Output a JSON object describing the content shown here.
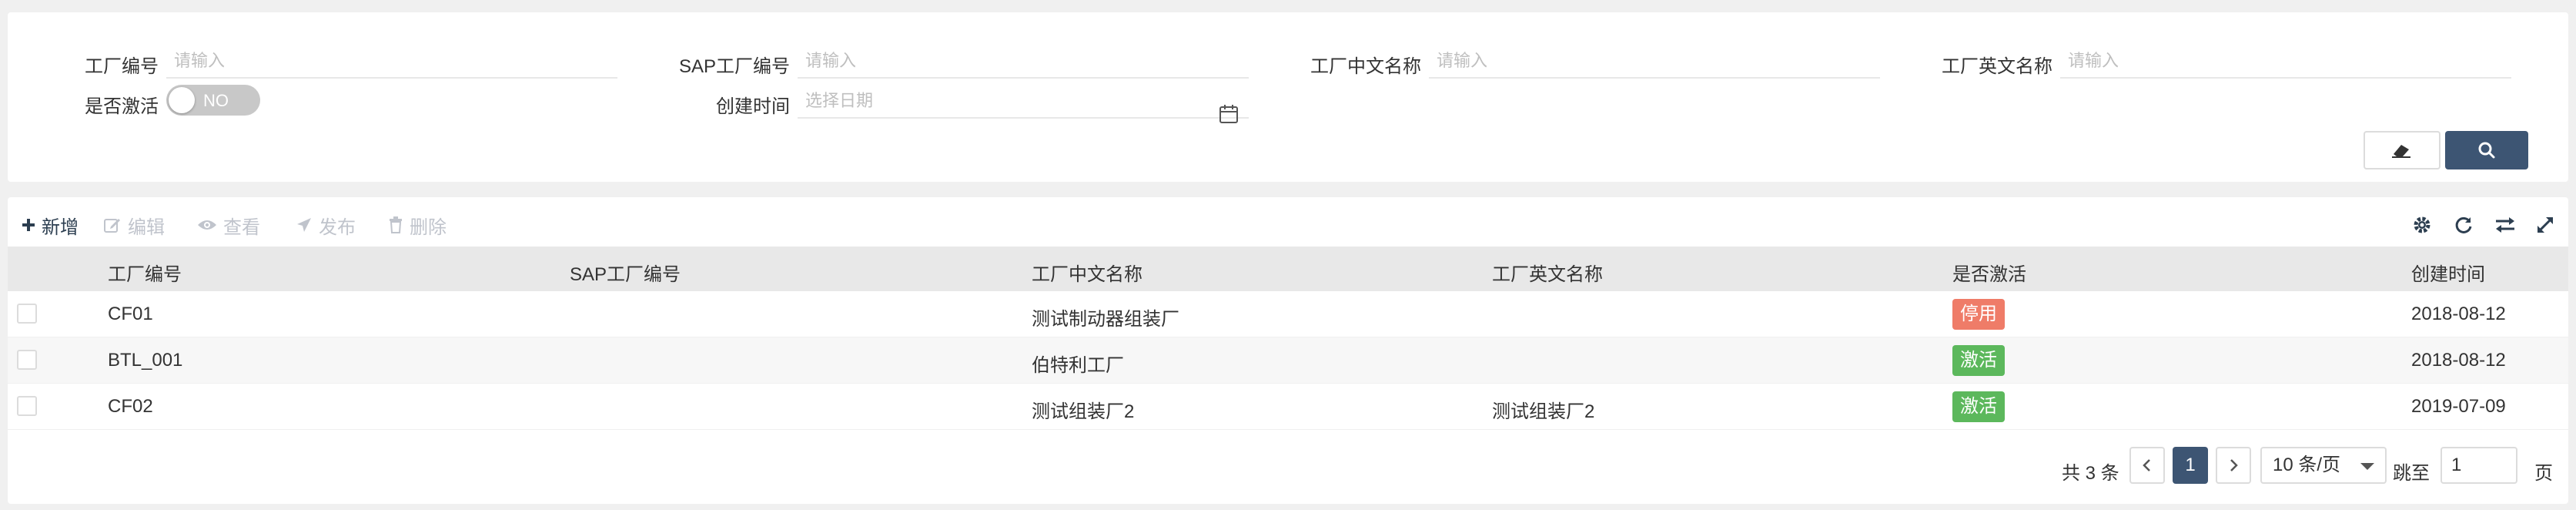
{
  "search": {
    "fields": [
      {
        "label": "工厂编号",
        "placeholder": "请输入"
      },
      {
        "label": "SAP工厂编号",
        "placeholder": "请输入"
      },
      {
        "label": "工厂中文名称",
        "placeholder": "请输入"
      },
      {
        "label": "工厂英文名称",
        "placeholder": "请输入"
      }
    ],
    "active_label": "是否激活",
    "active_toggle_text": "NO",
    "created_label": "创建时间",
    "created_placeholder": "选择日期"
  },
  "toolbar": {
    "add_label": "新增",
    "edit_label": "编辑",
    "view_label": "查看",
    "publish_label": "发布",
    "delete_label": "删除"
  },
  "table": {
    "columns": [
      "工厂编号",
      "SAP工厂编号",
      "工厂中文名称",
      "工厂英文名称",
      "是否激活",
      "创建时间"
    ],
    "rows": [
      {
        "code": "CF01",
        "sap_code": "",
        "name_cn": "测试制动器组装厂",
        "name_en": "",
        "status": "停用",
        "created": "2018-08-12"
      },
      {
        "code": "BTL_001",
        "sap_code": "",
        "name_cn": "伯特利工厂",
        "name_en": "",
        "status": "激活",
        "created": "2018-08-12"
      },
      {
        "code": "CF02",
        "sap_code": "",
        "name_cn": "测试组装厂2",
        "name_en": "测试组装厂2",
        "status": "激活",
        "created": "2019-07-09"
      }
    ]
  },
  "pagination": {
    "total_text": "共 3 条",
    "current_page": "1",
    "page_size": "10 条/页",
    "jump_label": "跳至",
    "jump_value": "1",
    "page_suffix": "页"
  },
  "colors": {
    "primary": "#3d5573",
    "inactive_badge": "#ef7c68",
    "active_badge": "#5cb85c"
  },
  "icons": {
    "add": "plus-icon",
    "edit": "edit-icon",
    "view": "eye-icon",
    "publish": "plane-icon",
    "delete": "trash-icon",
    "settings": "gear-icon",
    "refresh": "refresh-icon",
    "toggle_columns": "swap-icon",
    "fullscreen": "expand-icon",
    "reset": "eraser-icon",
    "search": "search-icon",
    "date": "calendar-icon"
  }
}
